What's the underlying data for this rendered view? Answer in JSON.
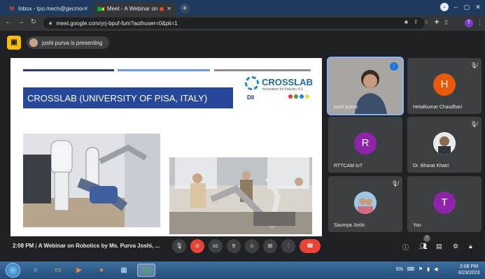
{
  "browser": {
    "tabs": [
      {
        "title": "Inbox - tpo.mech@gecmodasa.c",
        "favicon": "M",
        "active": false
      },
      {
        "title": "Meet - A Webinar on Roboti",
        "favicon": "meet-icon",
        "active": true
      }
    ],
    "new_tab": "+",
    "url": "meet.google.com/yrj-bpuf-fum?authuser=0&pli=1",
    "profile_initial": "T"
  },
  "meet": {
    "presenting_banner": "joshi purva is presenting",
    "slide": {
      "title": "CROSSLAB (UNIVERSITY OF PISA, ITALY)",
      "logo_name": "CROSSLAB",
      "logo_tagline": "Innovation for Industry 4.0",
      "logo_dept": "DII"
    },
    "participants": [
      {
        "name": "joshi purva",
        "initial": "",
        "color": "",
        "speaking": true
      },
      {
        "name": "Hetalkumar Chaudhari",
        "initial": "H",
        "color": "#e8590c",
        "speaking": false
      },
      {
        "name": "RTTCAM IoT",
        "initial": "R",
        "color": "#8e24aa",
        "speaking": false
      },
      {
        "name": "Dr. Bharat Khatri",
        "initial": "",
        "color": "",
        "speaking": false
      },
      {
        "name": "Saumya Joshi",
        "initial": "",
        "color": "",
        "speaking": false
      },
      {
        "name": "You",
        "initial": "T",
        "color": "#8e24aa",
        "speaking": false
      }
    ],
    "bottom": {
      "time": "2:08 PM",
      "separator": "|",
      "meeting_title": "A Webinar on Robotics by Ms. Purva Joshi, ...",
      "people_count": "7"
    }
  },
  "taskbar": {
    "language": "EN",
    "time": "2:08 PM",
    "date": "3/23/2023"
  }
}
